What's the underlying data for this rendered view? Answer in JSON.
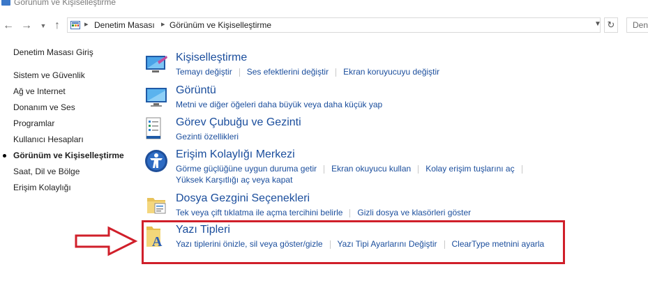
{
  "window": {
    "title": "Görünüm ve Kişiselleştirme"
  },
  "nav": {
    "back_icon": "back-arrow-icon",
    "forward_icon": "forward-arrow-icon",
    "recent_icon": "chevron-down-icon",
    "up_icon": "up-arrow-icon",
    "breadcrumb": [
      "Denetim Masası",
      "Görünüm ve Kişiselleştirme"
    ],
    "search_placeholder": "Den"
  },
  "sidebar": {
    "home": "Denetim Masası Giriş",
    "items": [
      {
        "label": "Sistem ve Güvenlik",
        "active": false
      },
      {
        "label": "Ağ ve Internet",
        "active": false
      },
      {
        "label": "Donanım ve Ses",
        "active": false
      },
      {
        "label": "Programlar",
        "active": false
      },
      {
        "label": "Kullanıcı Hesapları",
        "active": false
      },
      {
        "label": "Görünüm ve Kişiselleştirme",
        "active": true
      },
      {
        "label": "Saat, Dil ve Bölge",
        "active": false
      },
      {
        "label": "Erişim Kolaylığı",
        "active": false
      }
    ]
  },
  "categories": [
    {
      "title": "Kişiselleştirme",
      "icon": "personalization-icon",
      "links": [
        "Temayı değiştir",
        "Ses efektlerini değiştir",
        "Ekran koruyucuyu değiştir"
      ]
    },
    {
      "title": "Görüntü",
      "icon": "display-icon",
      "links": [
        "Metni ve diğer öğeleri daha büyük veya daha küçük yap"
      ]
    },
    {
      "title": "Görev Çubuğu ve Gezinti",
      "icon": "taskbar-icon",
      "links": [
        "Gezinti özellikleri"
      ]
    },
    {
      "title": "Erişim Kolaylığı Merkezi",
      "icon": "ease-of-access-icon",
      "links": [
        "Görme güçlüğüne uygun duruma getir",
        "Ekran okuyucu kullan",
        "Kolay erişim tuşlarını aç",
        "Yüksek Karşıtlığı aç veya kapat"
      ]
    },
    {
      "title": "Dosya Gezgini Seçenekleri",
      "icon": "folder-options-icon",
      "links": [
        "Tek veya çift tıklatma ile açma tercihini belirle",
        "Gizli dosya ve klasörleri göster"
      ]
    },
    {
      "title": "Yazı Tipleri",
      "icon": "fonts-folder-icon",
      "links": [
        "Yazı tiplerini önizle, sil veya göster/gizle",
        "Yazı Tipi Ayarlarını Değiştir",
        "ClearType metnini ayarla"
      ]
    }
  ],
  "annotation": {
    "color": "#d01f2a"
  },
  "colors": {
    "link": "#1a4d9c",
    "text": "#1e1e1e"
  }
}
